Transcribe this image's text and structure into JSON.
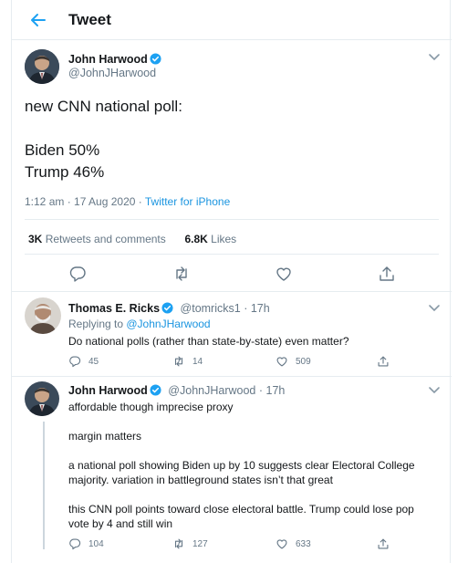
{
  "header": {
    "title": "Tweet"
  },
  "main_tweet": {
    "author_name": "John Harwood",
    "author_handle": "@JohnJHarwood",
    "text_line1": "new CNN national poll:",
    "text_line2": "Biden 50%",
    "text_line3": "Trump 46%",
    "time": "1:12 am · 17 Aug 2020 · ",
    "source": "Twitter for iPhone",
    "retweets_count": "3K",
    "retweets_label": "Retweets and comments",
    "likes_count": "6.8K",
    "likes_label": "Likes"
  },
  "reply1": {
    "author_name": "Thomas E. Ricks",
    "author_handle": "@tomricks1",
    "time": "· 17h",
    "replying_prefix": "Replying to ",
    "replying_to": "@JohnJHarwood",
    "text": "Do national polls (rather than state-by-state) even matter?",
    "replies": "45",
    "retweets": "14",
    "likes": "509"
  },
  "reply2": {
    "author_name": "John Harwood",
    "author_handle": "@JohnJHarwood",
    "time": "· 17h",
    "text_p1": "affordable though imprecise proxy",
    "text_p2": "margin matters",
    "text_p3a": "a national poll showing Biden up by 10 suggests clear Electoral College",
    "text_p3b": "majority. variation in battleground states isn’t that great",
    "text_p4a": "this CNN poll points toward close electoral battle. Trump could lose pop",
    "text_p4b": "vote by 4 and still win",
    "replies": "104",
    "retweets": "127",
    "likes": "633"
  },
  "colors": {
    "accent": "#1da1f2",
    "link": "#1b95e0",
    "muted": "#657786",
    "border": "#e6ecf0"
  },
  "icons": [
    "back-arrow-icon",
    "verified-badge-icon",
    "chevron-down-icon",
    "reply-icon",
    "retweet-icon",
    "like-icon",
    "share-icon"
  ]
}
